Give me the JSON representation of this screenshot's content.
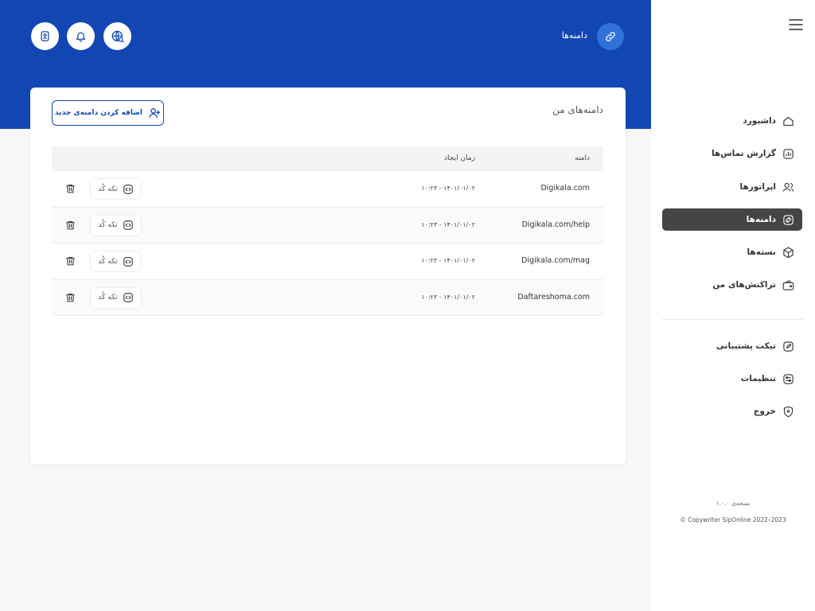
{
  "header": {
    "title": "دامنه‌ها",
    "buttons": [
      "globe-search-icon",
      "bell-icon",
      "badge-icon"
    ]
  },
  "card": {
    "title": "دامنه‌های من",
    "add_button_label": "اضافه کردن دامنه‌ی جدید"
  },
  "table": {
    "columns": {
      "domain": "دامنه",
      "created": "زمان ایجاد"
    },
    "rows": [
      {
        "domain": "Digikala.com",
        "created": "۱۴۰۱/۰۱/۰۲ - ۱۰:۲۳",
        "code_label": "تکه کُد"
      },
      {
        "domain": "Digikala.com/help",
        "created": "۱۴۰۱/۰۱/۰۲ - ۱۰:۲۳",
        "code_label": "تکه کُد"
      },
      {
        "domain": "Digikala.com/mag",
        "created": "۱۴۰۱/۰۱/۰۲ - ۱۰:۲۳",
        "code_label": "تکه کُد"
      },
      {
        "domain": "Daftareshoma.com",
        "created": "۱۴۰۱/۰۱/۰۲ - ۱۰:۲۳",
        "code_label": "تکه کُد"
      }
    ]
  },
  "sidebar": {
    "items": [
      {
        "label": "داشبورد",
        "icon": "home-icon"
      },
      {
        "label": "گزارش تماس‌ها",
        "icon": "chart-icon"
      },
      {
        "label": "اپراتورها",
        "icon": "users-icon"
      },
      {
        "label": "دامنه‌ها",
        "icon": "link-icon",
        "active": true
      },
      {
        "label": "بسته‌ها",
        "icon": "box-icon"
      },
      {
        "label": "تراکنش‌های من",
        "icon": "wallet-icon"
      },
      {
        "label": "تیکت پشتیبانی",
        "icon": "edit-icon"
      },
      {
        "label": "تنظیمات",
        "icon": "settings-icon"
      },
      {
        "label": "خروج",
        "icon": "logout-icon"
      }
    ],
    "version": "نسخه‌ی ۱.۰.۰",
    "copyright": "© Copywriter SipOnline 2022–2023"
  },
  "colors": {
    "primary": "#1247b3",
    "primary_light": "#2f72d8",
    "active_nav": "#454545"
  }
}
